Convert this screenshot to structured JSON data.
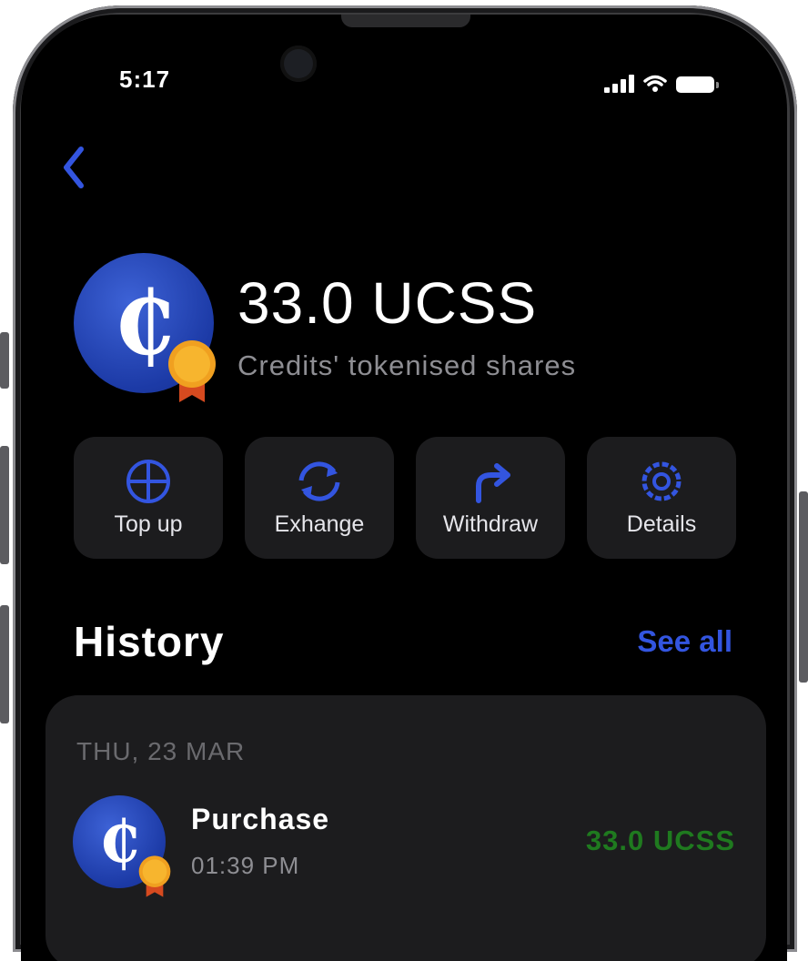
{
  "status_bar": {
    "time": "5:17"
  },
  "asset": {
    "amount": "33.0 UCSS",
    "name": "Credits' tokenised shares",
    "logo_symbol": "₵",
    "brand_color": "#1f3fb3"
  },
  "actions": [
    {
      "label": "Top up",
      "icon": "plus-circle-icon"
    },
    {
      "label": "Exhange",
      "icon": "exchange-icon"
    },
    {
      "label": "Withdraw",
      "icon": "share-arrow-icon"
    },
    {
      "label": "Details",
      "icon": "gear-icon"
    }
  ],
  "history": {
    "title": "History",
    "see_all": "See all",
    "groups": [
      {
        "date": "THU, 23 MAR",
        "items": [
          {
            "title": "Purchase",
            "time": "01:39 PM",
            "amount": "33.0 UCSS",
            "amount_color": "#1f7a1f"
          }
        ]
      }
    ]
  },
  "accent_color": "#3355e0"
}
